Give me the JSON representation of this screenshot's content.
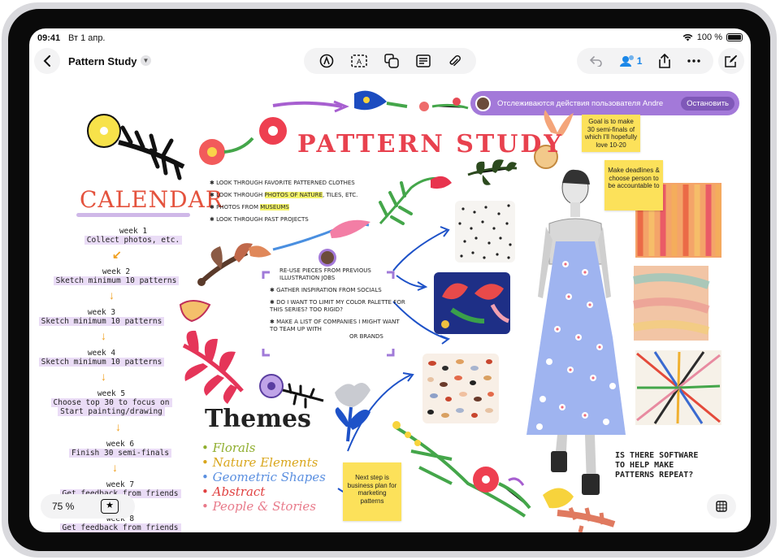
{
  "status_bar": {
    "time": "09:41",
    "date": "Вт 1 апр.",
    "battery": "100 %"
  },
  "toolbar": {
    "board_title": "Pattern Study",
    "collaborator_count": "1"
  },
  "follow_banner": {
    "text": "Отслеживаются действия пользователя Andre",
    "stop_label": "Остановить"
  },
  "canvas": {
    "title": "PATTERN STUDY",
    "calendar": {
      "title": "CALENDAR",
      "weeks": [
        {
          "label": "week 1",
          "task": "Collect photos, etc."
        },
        {
          "label": "week 2",
          "task": "Sketch minimum 10 patterns"
        },
        {
          "label": "week 3",
          "task": "Sketch minimum 10 patterns"
        },
        {
          "label": "week 4",
          "task": "Sketch minimum 10 patterns"
        },
        {
          "label": "week 5",
          "task": "Choose top 30 to focus on",
          "task2": "Start painting/drawing"
        },
        {
          "label": "week 6",
          "task": "Finish 30 semi-finals"
        },
        {
          "label": "week 7",
          "task": "Get feedback from friends"
        },
        {
          "label": "week 8",
          "task": "Get feedback from friends"
        }
      ]
    },
    "notes_top": [
      "LOOK THROUGH FAVORITE PATTERNED CLOTHES",
      "LOOK THROUGH",
      "PHOTOS OF NATURE",
      ", TILES, ETC.",
      "PHOTOS FROM",
      "MUSEUMS",
      "LOOK THROUGH PAST PROJECTS"
    ],
    "notes_middle": [
      "RE-USE PIECES FROM PREVIOUS",
      "ILLUSTRATION JOBS",
      "GATHER INSPIRATION FROM SOCIALS",
      "DO I WANT TO LIMIT MY COLOR PALETTE FOR",
      "THIS SERIES? TOO RIGID?",
      "MAKE A LIST OF COMPANIES I MIGHT WANT",
      "TO TEAM UP WITH",
      "OR BRANDS"
    ],
    "themes": {
      "title": "Themes",
      "items": [
        {
          "text": "Florals",
          "color": "#8fae2e"
        },
        {
          "text": "Nature Elements",
          "color": "#d9a61c"
        },
        {
          "text": "Geometric Shapes",
          "color": "#5a8fe0"
        },
        {
          "text": "Abstract",
          "color": "#e04040"
        },
        {
          "text": "People & Stories",
          "color": "#e87a8a"
        }
      ]
    },
    "stickies": {
      "goal": "Goal is to make 30 semi-finals of which I'll hopefully love 10-20",
      "deadlines": "Make deadlines & choose person to be accountable to",
      "next_step": "Next step is business plan for marketing patterns"
    },
    "question": "IS THERE SOFTWARE TO HELP MAKE PATTERNS REPEAT?"
  },
  "zoom": {
    "level": "75 %"
  },
  "colors": {
    "accent": "#1a87e8",
    "banner": "#a379d9",
    "sticky": "#fce15a"
  }
}
